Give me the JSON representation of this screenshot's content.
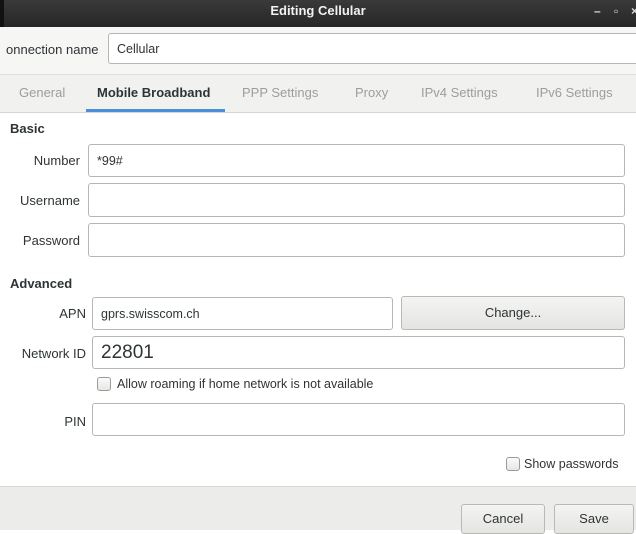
{
  "window": {
    "title": "Editing Cellular",
    "minimize_glyph": "–",
    "maximize_glyph": "▫",
    "close_glyph": "×"
  },
  "connection": {
    "name_label": "onnection name",
    "name_value": "Cellular"
  },
  "tabs": [
    {
      "label": "General",
      "active": false
    },
    {
      "label": "Mobile Broadband",
      "active": true
    },
    {
      "label": "PPP Settings",
      "active": false
    },
    {
      "label": "Proxy",
      "active": false
    },
    {
      "label": "IPv4 Settings",
      "active": false
    },
    {
      "label": "IPv6 Settings",
      "active": false
    }
  ],
  "basic": {
    "heading": "Basic",
    "number_label": "Number",
    "number_value": "*99#",
    "username_label": "Username",
    "username_value": "",
    "password_label": "Password",
    "password_value": ""
  },
  "advanced": {
    "heading": "Advanced",
    "apn_label": "APN",
    "apn_value": "gprs.swisscom.ch",
    "change_button": "Change...",
    "network_id_label": "Network ID",
    "network_id_value": "22801",
    "roaming_label": "Allow roaming if home network is not available",
    "roaming_checked": false,
    "pin_label": "PIN",
    "pin_value": ""
  },
  "show_passwords": {
    "label": "Show passwords",
    "checked": false
  },
  "footer": {
    "cancel_button": "Cancel",
    "save_button": "Save"
  },
  "colors": {
    "accent": "#4a90d9",
    "titlebar": "#2b2b2b"
  }
}
